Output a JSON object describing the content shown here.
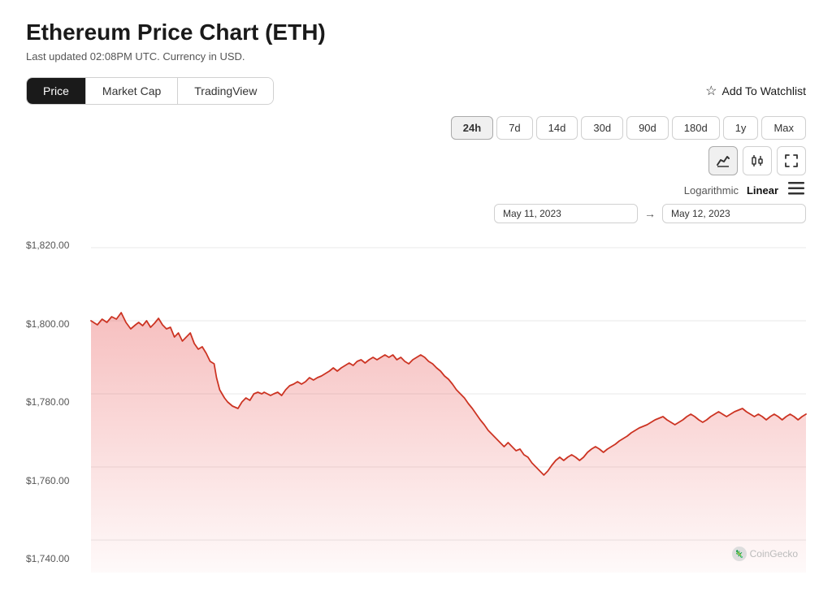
{
  "page": {
    "title": "Ethereum Price Chart (ETH)",
    "subtitle": "Last updated 02:08PM UTC. Currency in USD.",
    "watchlist_label": "Add To Watchlist"
  },
  "chart_tabs": [
    {
      "label": "Price",
      "active": true
    },
    {
      "label": "Market Cap",
      "active": false
    },
    {
      "label": "TradingView",
      "active": false
    }
  ],
  "time_ranges": [
    {
      "label": "24h",
      "active": true
    },
    {
      "label": "7d",
      "active": false
    },
    {
      "label": "14d",
      "active": false
    },
    {
      "label": "30d",
      "active": false
    },
    {
      "label": "90d",
      "active": false
    },
    {
      "label": "180d",
      "active": false
    },
    {
      "label": "1y",
      "active": false
    },
    {
      "label": "Max",
      "active": false
    }
  ],
  "chart_type_buttons": [
    {
      "name": "line-chart-icon",
      "icon": "📈",
      "active": true
    },
    {
      "name": "candlestick-icon",
      "icon": "📊",
      "active": false
    },
    {
      "name": "fullscreen-icon",
      "icon": "⛶",
      "active": false
    }
  ],
  "scale": {
    "logarithmic_label": "Logarithmic",
    "linear_label": "Linear",
    "active": "linear"
  },
  "date_range": {
    "from": "May 11, 2023",
    "to": "May 12, 2023"
  },
  "y_axis_labels": [
    "$1,820.00",
    "$1,800.00",
    "$1,780.00",
    "$1,760.00",
    "$1,740.00"
  ],
  "watermark": "CoinGecko"
}
